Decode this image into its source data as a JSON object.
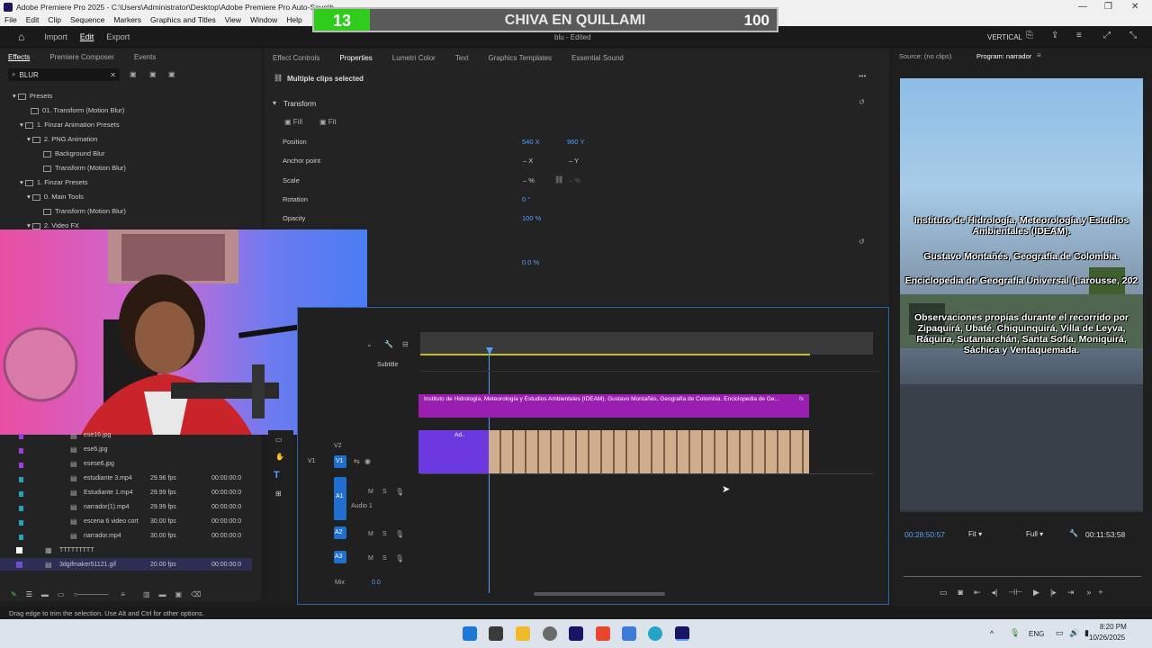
{
  "window": {
    "title": "Adobe Premiere Pro 2025 - C:\\Users\\Administrator\\Desktop\\Adobe Premiere Pro Auto-Save\\b",
    "doc_title": "blu - Edited",
    "menu": [
      "File",
      "Edit",
      "Clip",
      "Sequence",
      "Markers",
      "Graphics and Titles",
      "View",
      "Window",
      "Help"
    ]
  },
  "overlay_scoreboard": {
    "left": "13",
    "title": "CHIVA EN QUILLAMI",
    "right": "100"
  },
  "header": {
    "nav": [
      "Import",
      "Edit",
      "Export"
    ],
    "active": "Edit",
    "workspace": "VERTICAL"
  },
  "effects_panel": {
    "tabs": [
      "Effects",
      "Premiere Composer",
      "Events"
    ],
    "search_value": "BLUR",
    "tree": [
      "Presets",
      "01. Transform (Motion Blur)",
      "1. Finzar Animation Presets",
      "2. PNG Animation",
      "Background Blur",
      "Transform (Motion Blur)",
      "1. Finzar Presets",
      "0. Main Tools",
      "Transform (Motion Blur)",
      "2. Video FX"
    ]
  },
  "project_panel": {
    "items": [
      {
        "name": "ese16.jpg",
        "fps": "",
        "dur": ""
      },
      {
        "name": "ese6.jpg",
        "fps": "",
        "dur": ""
      },
      {
        "name": "esese6.jpg",
        "fps": "",
        "dur": ""
      },
      {
        "name": "estudiante 3.mp4",
        "fps": "29.96 fps",
        "dur": "00:00:00:0"
      },
      {
        "name": "Estudiante 1.mp4",
        "fps": "29.99 fps",
        "dur": "00:00:00:0"
      },
      {
        "name": "narrador(1).mp4",
        "fps": "29.99 fps",
        "dur": "00:00:00:0"
      },
      {
        "name": "escena 6 video cort",
        "fps": "30.00 fps",
        "dur": "00:00:00:0"
      },
      {
        "name": "narrador.mp4",
        "fps": "30.00 fps",
        "dur": "00:00:00:0"
      },
      {
        "name": "TTTTTTTTT",
        "fps": "",
        "dur": ""
      },
      {
        "name": "3dgifmaker51121.gif",
        "fps": "20.00 fps",
        "dur": "00:00:00:0"
      }
    ]
  },
  "properties_panel": {
    "tabs": [
      "Effect Controls",
      "Properties",
      "Lumetri Color",
      "Text",
      "Graphics Templates",
      "Essential Sound"
    ],
    "active_tab": "Properties",
    "selection": "Multiple clips selected",
    "section": "Transform",
    "fill": "Fill",
    "fit": "Fit",
    "rows": [
      {
        "label": "Position",
        "v1": "540 X",
        "v2": "960 Y"
      },
      {
        "label": "Anchor point",
        "v1": "– X",
        "v2": "– Y"
      },
      {
        "label": "Scale",
        "v1": "– %",
        "v2": "– %"
      },
      {
        "label": "Rotation",
        "v1": "0 °",
        "v2": ""
      },
      {
        "label": "Opacity",
        "v1": "100 %",
        "v2": ""
      }
    ],
    "extra_value": "0.0 %"
  },
  "monitor": {
    "source_tab": "Source: (no clips)",
    "program_tab": "Program: narrador",
    "timecode": "00:28:50:57",
    "fit": "Fit",
    "full": "Full",
    "duration": "00:11:53:58",
    "overlay_lines": [
      "Instituto de Hidrología, Meteorología y Estudios Ambientales (IDEAM).",
      "Gustavo Montañés, Geografía de Colombia.",
      "Enciclopedia de Geografía Universal (Larousse, 202",
      "Observaciones propias durante el recorrido por Zipaquirá, Ubaté, Chiquinquirá, Villa de Leyva, Ráquira, Sutamarchán, Santa Sofía, Moniquirá, Sáchica y Ventaquemada."
    ]
  },
  "timeline": {
    "subtitle_label": "Subtitle",
    "text_clip": "Instituto de Hidrología, Meteorología y Estudios Ambientales (IDEAM). Gustavo Montañés, Geografía de Colombia. Enciclopedia de Ge...",
    "tracks": [
      "V2",
      "V1",
      "A1",
      "A2",
      "A3"
    ],
    "audio1_label": "Audio 1",
    "mix_label": "Mix",
    "mix_value": "0.0",
    "clip_label": "Ad.."
  },
  "status_text": "Drag edge to trim the selection. Use Alt and Ctrl for other options.",
  "taskbar": {
    "lang": "ENG",
    "time": "8:20 PM",
    "date": "10/26/2025"
  }
}
